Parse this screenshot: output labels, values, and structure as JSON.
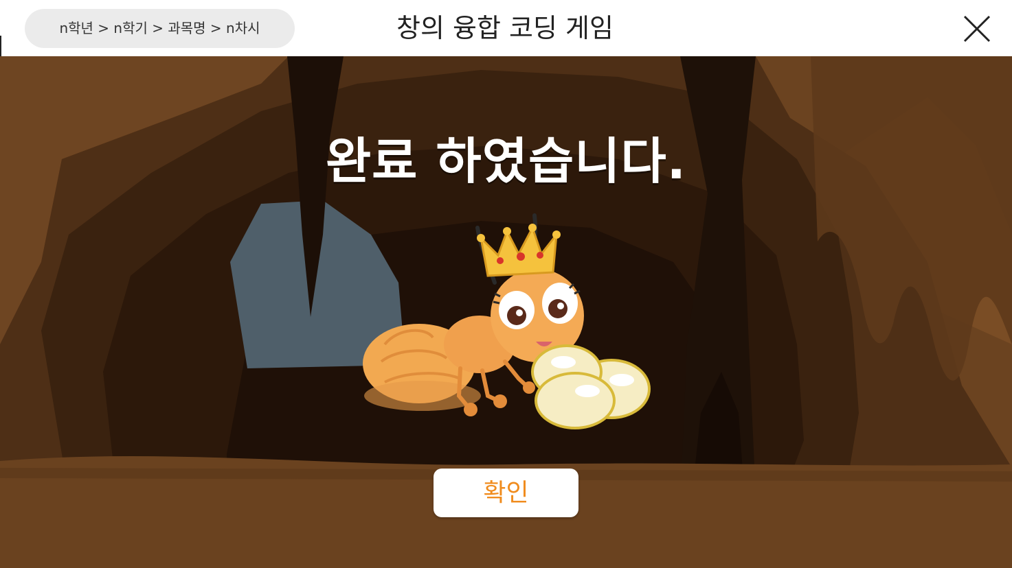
{
  "header": {
    "breadcrumb": "n학년 > n학기 > 과목명 > n차시",
    "title": "창의 융합 코딩 게임",
    "close_icon": "close-icon"
  },
  "result": {
    "message": "완료 하였습니다.",
    "confirm_label": "확인"
  },
  "colors": {
    "accent": "#f08c1e",
    "cave_floor": "#6a421f",
    "cave_wall": "#4a2e17",
    "cave_inner": "#2a170b",
    "ant_body": "#f2a951"
  }
}
